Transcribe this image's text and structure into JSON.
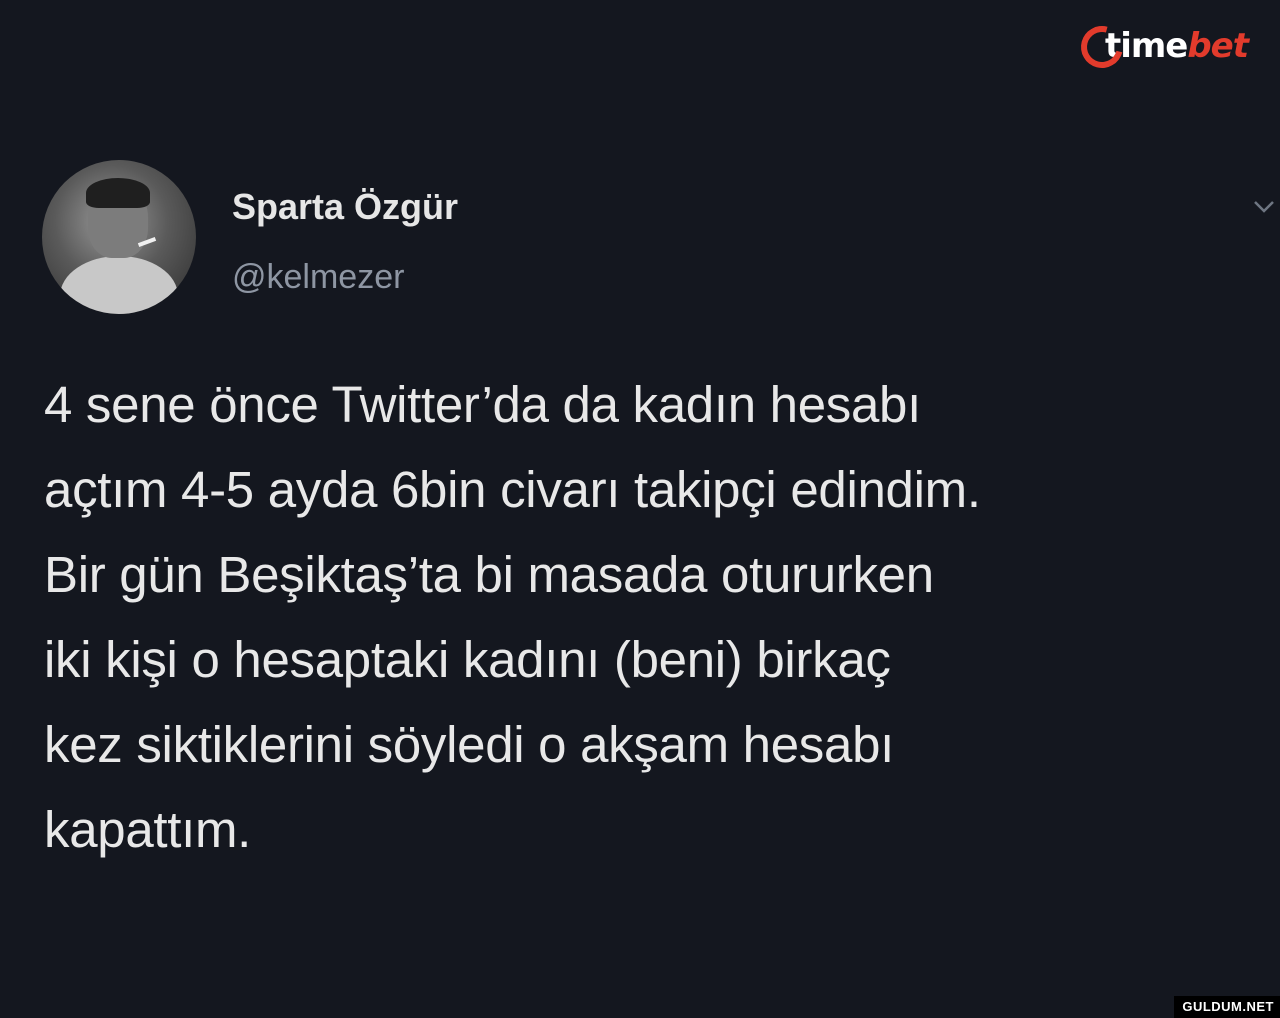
{
  "brand": {
    "logo_text_1": "time",
    "logo_text_2": "bet",
    "accent": "#e23b2c"
  },
  "tweet": {
    "display_name": "Sparta Özgür",
    "handle": "@kelmezer",
    "lines": [
      "4 sene önce Twitter’da da  kadın hesabı",
      "açtım 4-5 ayda 6bin civarı takipçi edindim.",
      "Bir gün Beşiktaş’ta bi masada otururken",
      "iki kişi o hesaptaki kadını (beni) birkaç",
      "kez siktiklerini söyledi o akşam hesabı",
      "kapattım."
    ],
    "menu_icon": "chevron-down-icon"
  },
  "watermark": "GULDUM.NET",
  "colors": {
    "background": "#14171f",
    "text": "#e8e8e8",
    "muted": "#8e96a3"
  }
}
